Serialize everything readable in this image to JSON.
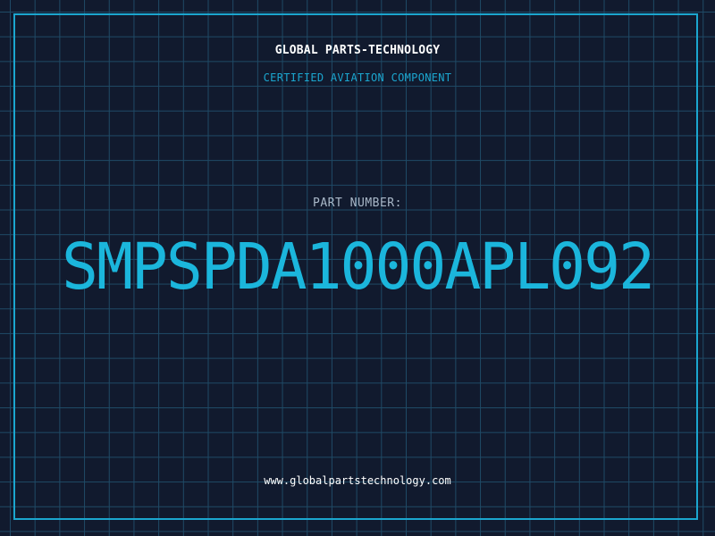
{
  "header": {
    "company": "GLOBAL PARTS-TECHNOLOGY",
    "subtitle": "CERTIFIED AVIATION COMPONENT"
  },
  "part": {
    "label": "PART NUMBER:",
    "number": "SMPSPDA1000APL092"
  },
  "footer": {
    "website": "www.globalpartstechnology.com"
  },
  "colors": {
    "background": "#111a2e",
    "grid": "#1f4a66",
    "accent": "#1bb6dc",
    "frame": "#1ba6cf"
  }
}
